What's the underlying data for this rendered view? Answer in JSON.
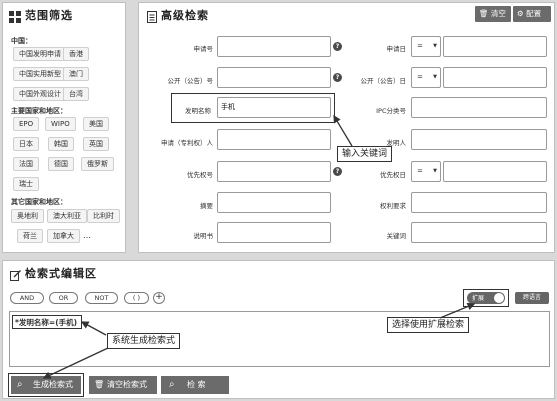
{
  "filter": {
    "title": "范围筛选",
    "china_label": "中国：",
    "china_items": [
      "中国发明申请",
      "香港",
      "中国实用新型",
      "澳门",
      "中国外观设计",
      "台湾"
    ],
    "major_label": "主要国家和地区：",
    "major_items": [
      "EPO",
      "WIPO",
      "美国",
      "日本",
      "韩国",
      "英国",
      "法国",
      "德国",
      "俄罗斯",
      "瑞士"
    ],
    "other_label": "其它国家和地区：",
    "other_items": [
      "奥地利",
      "澳大利亚",
      "比利时",
      "荷兰",
      "加拿大"
    ],
    "more": "…"
  },
  "advanced": {
    "title": "高级检索",
    "clear_label": "清空",
    "config_label": "配置",
    "fields": {
      "app_no": "申请号",
      "app_date": "申请日",
      "pub_no": "公开（公告）号",
      "pub_date": "公开（公告）日",
      "title": "发明名称",
      "title_value": "手机",
      "ipc": "IPC分类号",
      "applicant": "申请（专利权）人",
      "inventor": "发明人",
      "priority_no": "优先权号",
      "priority_date": "优先权日",
      "abstract": "摘要",
      "claims": "权利要求",
      "description": "说明书",
      "keywords": "关键词"
    },
    "date_op": "=",
    "help_mark": "?"
  },
  "editor": {
    "title": "检索式编辑区",
    "ops": [
      "AND",
      "OR",
      "NOT",
      "( )"
    ],
    "plus": "+",
    "expand_label": "扩展",
    "translate_label": "跨语言",
    "query": "*发明名称=(手机)"
  },
  "bottom": {
    "generate_label": "生成检索式",
    "clear_query_label": "清空检索式",
    "search_label": "检 索"
  },
  "annotations": {
    "keyword_callout": "输入关键词",
    "system_callout": "系统生成检索式",
    "expand_callout": "选择使用扩展检索"
  }
}
